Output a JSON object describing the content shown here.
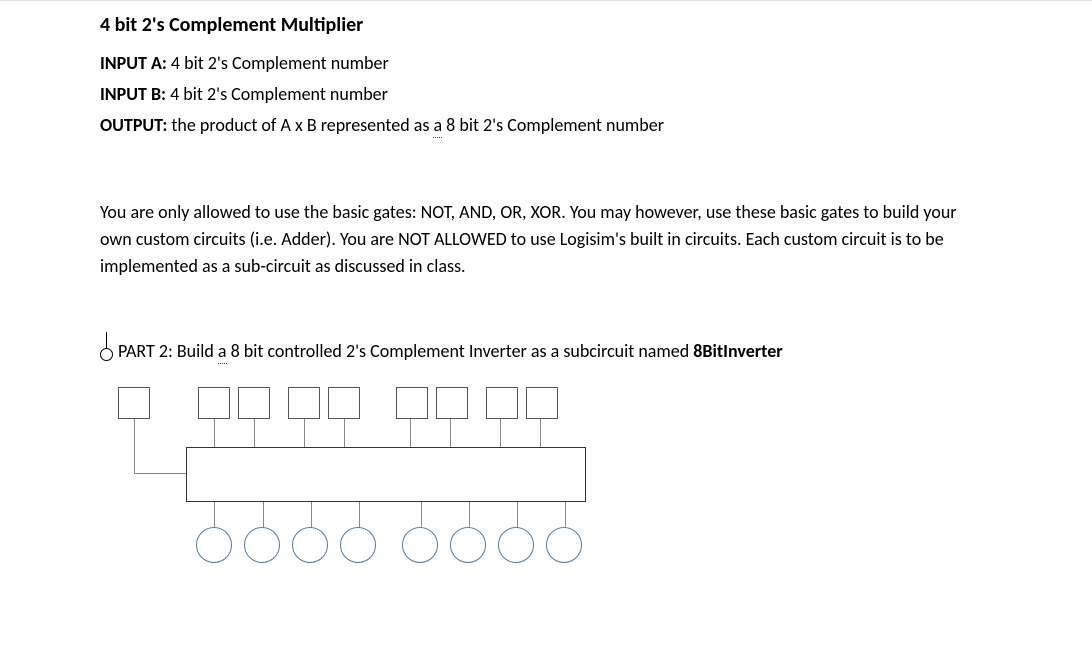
{
  "title": "4 bit 2's Complement Multiplier",
  "inputA": {
    "label": "INPUT A:",
    "text": " 4 bit 2's Complement number"
  },
  "inputB": {
    "label": "INPUT B:",
    "text": " 4 bit 2's Complement number"
  },
  "output": {
    "label": "OUTPUT:",
    "text_before": " the product of A x B represented as ",
    "a": "a",
    "text_after": " 8 bit 2's Complement number"
  },
  "rules": "You are only allowed to use the basic gates: NOT, AND, OR, XOR. You may however, use these basic gates to build your own custom circuits (i.e. Adder). You are NOT ALLOWED to use Logisim's built in circuits. Each custom circuit is to be implemented as a sub-circuit as discussed in class.",
  "part2": {
    "label": "PART 2",
    "text_before": ": Build ",
    "a": "a",
    "text_after": " 8 bit controlled 2's Complement Inverter as a subcircuit named ",
    "name": "8BitInverter"
  }
}
